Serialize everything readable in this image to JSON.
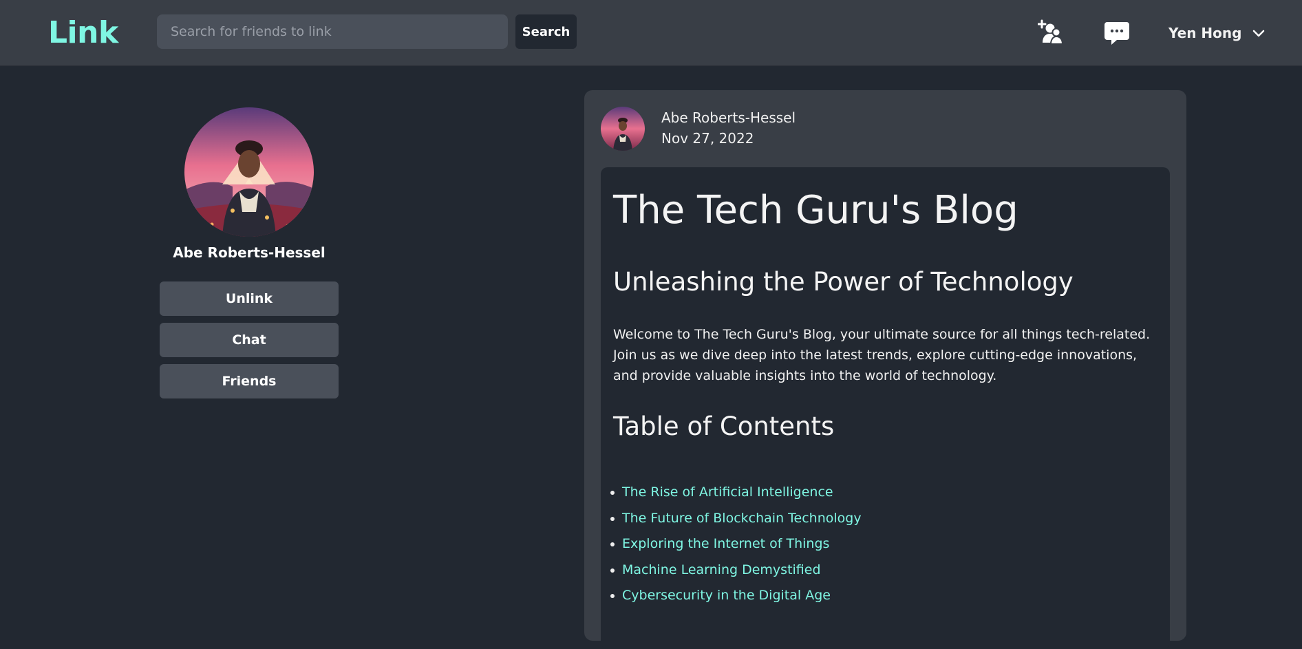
{
  "navbar": {
    "brand": "Link",
    "search_placeholder": "Search for friends to link",
    "search_label": "Search",
    "user_name": "Yen Hong",
    "icons": {
      "add_friend": "add-friend-icon",
      "chat": "chat-bubble-icon",
      "dropdown": "chevron-down-icon"
    }
  },
  "profile": {
    "name": "Abe Roberts-Hessel",
    "buttons": {
      "unlink": "Unlink",
      "chat": "Chat",
      "friends": "Friends"
    }
  },
  "post": {
    "author": "Abe Roberts-Hessel",
    "date": "Nov 27, 2022",
    "title": "The Tech Guru's Blog",
    "subtitle": "Unleashing the Power of Technology",
    "intro": "Welcome to The Tech Guru's Blog, your ultimate source for all things tech-related. Join us as we dive deep into the latest trends, explore cutting-edge innovations, and provide valuable insights into the world of technology.",
    "toc_heading": "Table of Contents",
    "toc": [
      "The Rise of Artificial Intelligence",
      "The Future of Blockchain Technology",
      "Exploring the Internet of Things",
      "Machine Learning Demystified",
      "Cybersecurity in the Digital Age"
    ]
  },
  "colors": {
    "background": "#222831",
    "surface": "#393e46",
    "accent": "#7ff6e3",
    "button": "#4a505a"
  }
}
